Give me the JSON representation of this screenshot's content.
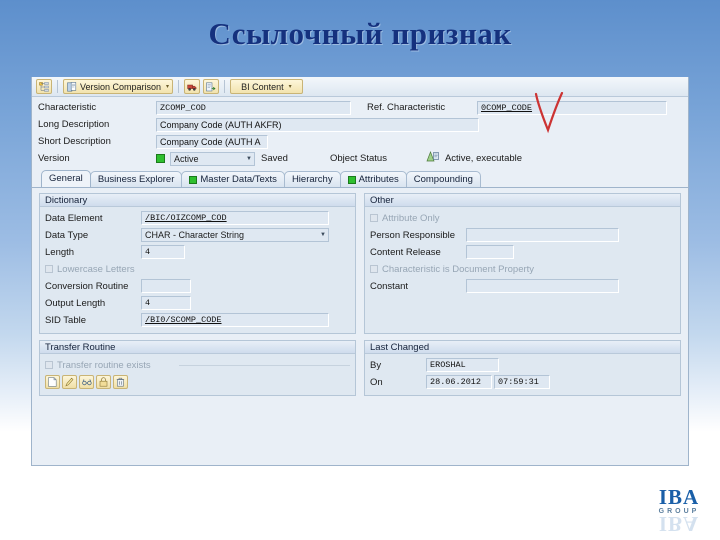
{
  "slide": {
    "title": "Ссылочный признак",
    "bg_top_color": "#5d8fcc",
    "bg_bottom_color": "#ffffff",
    "title_color": "#15317e"
  },
  "annotation": {
    "mark": "V",
    "color": "#cc3333"
  },
  "toolbar": {
    "hierarchy_icon": "hierarchy-icon",
    "version_comparison_label": "Version Comparison",
    "version_comparison_icon": "compare-documents-icon",
    "transport_icon": "truck-transport-icon",
    "where_used_icon": "where-used-list-icon",
    "bi_content_label": "BI Content",
    "caret": "▾"
  },
  "header": {
    "characteristic_label": "Characteristic",
    "characteristic_value": "ZCOMP_COD",
    "ref_characteristic_label": "Ref. Characteristic",
    "ref_characteristic_value": "0COMP_CODE",
    "long_description_label": "Long Description",
    "long_description_value": "Company Code (AUTH AKFR)",
    "short_description_label": "Short Description",
    "short_description_value": "Company Code (AUTH A",
    "version_label": "Version",
    "version_value": "Active",
    "version_status_icon": "green-square-status-icon",
    "saved_label": "Saved",
    "object_status_label": "Object Status",
    "object_status_icon": "active-executable-icon",
    "object_status_value": "Active, executable",
    "combo_arrow": "▼"
  },
  "tabs": [
    {
      "label": "General",
      "active": true,
      "icon": null
    },
    {
      "label": "Business Explorer",
      "active": false,
      "icon": null
    },
    {
      "label": "Master Data/Texts",
      "active": false,
      "icon": "green-square-icon"
    },
    {
      "label": "Hierarchy",
      "active": false,
      "icon": null
    },
    {
      "label": "Attributes",
      "active": false,
      "icon": "green-square-icon"
    },
    {
      "label": "Compounding",
      "active": false,
      "icon": null
    }
  ],
  "dictionary": {
    "title": "Dictionary",
    "data_element_label": "Data Element",
    "data_element_value": "/BIC/OIZCOMP_COD",
    "data_type_label": "Data Type",
    "data_type_value": "CHAR - Character String",
    "length_label": "Length",
    "length_value": "4",
    "lowercase_label": "Lowercase Letters",
    "lowercase_checked": false,
    "conversion_routine_label": "Conversion Routine",
    "conversion_routine_value": "",
    "output_length_label": "Output Length",
    "output_length_value": "4",
    "sid_table_label": "SID Table",
    "sid_table_value": "/BI0/SCOMP_CODE"
  },
  "other": {
    "title": "Other",
    "attribute_only_label": "Attribute Only",
    "attribute_only_checked": false,
    "person_responsible_label": "Person Responsible",
    "person_responsible_value": "",
    "content_release_label": "Content Release",
    "content_release_value": "",
    "document_property_label": "Characteristic is Document Property",
    "document_property_checked": false,
    "constant_label": "Constant",
    "constant_value": ""
  },
  "transfer_routine": {
    "title": "Transfer Routine",
    "exists_label": "Transfer routine exists",
    "exists_checked": false,
    "buttons": [
      {
        "name": "create-routine-button",
        "icon": "page-icon"
      },
      {
        "name": "edit-routine-button",
        "icon": "pencil-icon"
      },
      {
        "name": "display-routine-button",
        "icon": "glasses-icon"
      },
      {
        "name": "lock-routine-button",
        "icon": "lock-icon"
      },
      {
        "name": "delete-routine-button",
        "icon": "trash-icon"
      }
    ]
  },
  "last_changed": {
    "title": "Last Changed",
    "by_label": "By",
    "by_value": "EROSHAL",
    "on_label": "On",
    "on_date": "28.06.2012",
    "on_time": "07:59:31"
  },
  "logo": {
    "main": "IBA",
    "sub": "GROUP"
  }
}
